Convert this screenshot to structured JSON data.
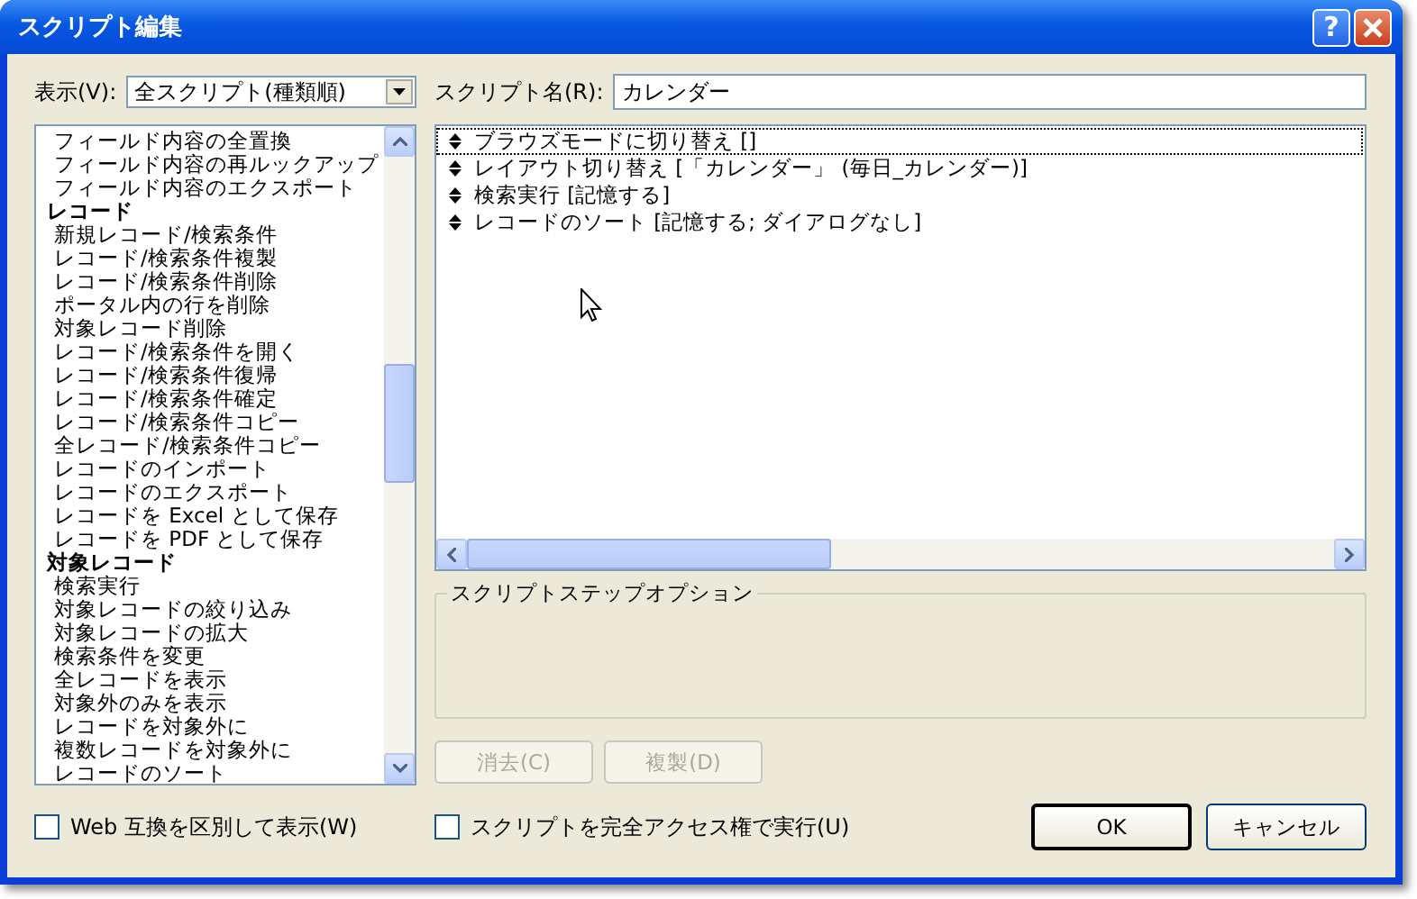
{
  "window": {
    "title": "スクリプト編集",
    "help_button": "?"
  },
  "view": {
    "label": "表示(V):",
    "value": "全スクリプト(種類順)"
  },
  "script_name": {
    "label": "スクリプト名(R):",
    "value": "カレンダー"
  },
  "step_library": [
    {
      "kind": "item",
      "label": "フィールド内容の全置換"
    },
    {
      "kind": "item",
      "label": "フィールド内容の再ルックアップ"
    },
    {
      "kind": "item",
      "label": "フィールド内容のエクスポート"
    },
    {
      "kind": "header",
      "label": "レコード"
    },
    {
      "kind": "item",
      "label": "新規レコード/検索条件"
    },
    {
      "kind": "item",
      "label": "レコード/検索条件複製"
    },
    {
      "kind": "item",
      "label": "レコード/検索条件削除"
    },
    {
      "kind": "item",
      "label": "ポータル内の行を削除"
    },
    {
      "kind": "item",
      "label": "対象レコード削除"
    },
    {
      "kind": "item",
      "label": "レコード/検索条件を開く"
    },
    {
      "kind": "item",
      "label": "レコード/検索条件復帰"
    },
    {
      "kind": "item",
      "label": "レコード/検索条件確定"
    },
    {
      "kind": "item",
      "label": "レコード/検索条件コピー"
    },
    {
      "kind": "item",
      "label": "全レコード/検索条件コピー"
    },
    {
      "kind": "item",
      "label": "レコードのインポート"
    },
    {
      "kind": "item",
      "label": "レコードのエクスポート"
    },
    {
      "kind": "item",
      "label": "レコードを Excel として保存"
    },
    {
      "kind": "item",
      "label": "レコードを PDF として保存"
    },
    {
      "kind": "header",
      "label": "対象レコード"
    },
    {
      "kind": "item",
      "label": "検索実行"
    },
    {
      "kind": "item",
      "label": "対象レコードの絞り込み"
    },
    {
      "kind": "item",
      "label": "対象レコードの拡大"
    },
    {
      "kind": "item",
      "label": "検索条件を変更"
    },
    {
      "kind": "item",
      "label": "全レコードを表示"
    },
    {
      "kind": "item",
      "label": "対象外のみを表示"
    },
    {
      "kind": "item",
      "label": "レコードを対象外に"
    },
    {
      "kind": "item",
      "label": "複数レコードを対象外に"
    },
    {
      "kind": "item",
      "label": "レコードのソート"
    }
  ],
  "script_steps": [
    {
      "text": "ブラウズモードに切り替え []",
      "focused": true
    },
    {
      "text": "レイアウト切り替え [「カレンダー」 (毎日_カレンダー)]",
      "focused": false
    },
    {
      "text": "検索実行 [記憶する]",
      "focused": false
    },
    {
      "text": "レコードのソート [記憶する; ダイアログなし]",
      "focused": false
    }
  ],
  "options_group": {
    "title": "スクリプトステップオプション"
  },
  "step_buttons": [
    {
      "label": "消去(C)",
      "disabled": true
    },
    {
      "label": "複製(D)",
      "disabled": true
    }
  ],
  "web_compat": {
    "label": "Web 互換を区別して表示(W)",
    "checked": false
  },
  "full_access": {
    "label": "スクリプトを完全アクセス権で実行(U)",
    "checked": false
  },
  "dialog_buttons": [
    {
      "label": "OK",
      "default": true
    },
    {
      "label": "キャンセル",
      "default": false
    }
  ]
}
